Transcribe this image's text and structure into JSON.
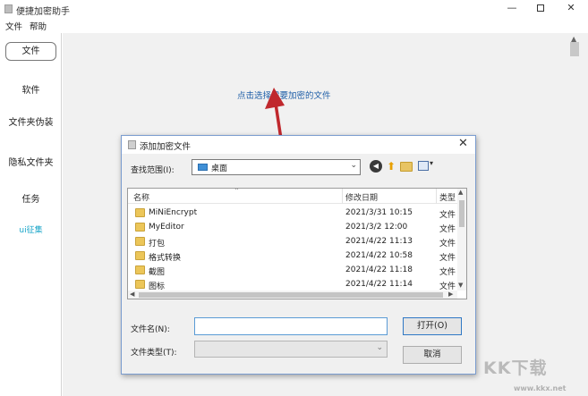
{
  "window": {
    "title": "便捷加密助手",
    "minimize": "—",
    "close": "✕"
  },
  "menu": {
    "file": "文件",
    "help": "帮助"
  },
  "sidebar": {
    "items": [
      {
        "label": "文件"
      },
      {
        "label": "软件"
      },
      {
        "label": "文件夹伪装"
      },
      {
        "label": "隐私文件夹"
      },
      {
        "label": "任务"
      },
      {
        "label": "ui征集"
      }
    ]
  },
  "main": {
    "prompt_link": "点击选择需要加密的文件"
  },
  "dialog": {
    "title": "添加加密文件",
    "close": "✕",
    "look_in_label": "查找范围(I):",
    "look_in_value": "桌面",
    "columns": {
      "name": "名称",
      "date": "修改日期",
      "type": "类型"
    },
    "rows": [
      {
        "name": "MiNiEncrypt",
        "date": "2021/3/31 10:15",
        "type": "文件"
      },
      {
        "name": "MyEditor",
        "date": "2021/3/2 12:00",
        "type": "文件"
      },
      {
        "name": "打包",
        "date": "2021/4/22 11:13",
        "type": "文件"
      },
      {
        "name": "格式转换",
        "date": "2021/4/22 10:58",
        "type": "文件"
      },
      {
        "name": "截图",
        "date": "2021/4/22 11:18",
        "type": "文件"
      },
      {
        "name": "图标",
        "date": "2021/4/22 11:14",
        "type": "文件"
      }
    ],
    "file_name_label": "文件名(N):",
    "file_name_value": "",
    "file_type_label": "文件类型(T):",
    "file_type_value": "",
    "open_button": "打开(O)",
    "cancel_button": "取消"
  },
  "watermark": {
    "logo": "KK下载",
    "url": "www.kkx.net"
  },
  "colors": {
    "link": "#1f5fa8",
    "accent_ui": "#1aa6c9",
    "arrow": "#c0282d",
    "folder": "#ecc659"
  }
}
